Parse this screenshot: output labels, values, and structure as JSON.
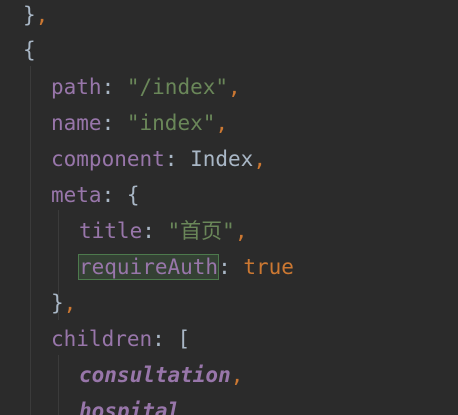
{
  "code": {
    "l1_brace": "}",
    "l1_comma": ",",
    "l2_brace": "{",
    "path_key": "path",
    "path_colon": ": ",
    "path_val": "\"/index\"",
    "path_comma": ",",
    "name_key": "name",
    "name_colon": ": ",
    "name_val": "\"index\"",
    "name_comma": ",",
    "component_key": "component",
    "component_colon": ": ",
    "component_val": "Index",
    "component_comma": ",",
    "meta_key": "meta",
    "meta_colon": ": {",
    "title_key": "title",
    "title_colon": ": ",
    "title_val": "\"首页\"",
    "title_comma": ",",
    "require_key": "requireAuth",
    "require_colon": ": ",
    "require_val": "true",
    "meta_close": "}",
    "meta_close_comma": ",",
    "children_key": "children",
    "children_colon": ": [",
    "child1": "consultation",
    "child1_comma": ",",
    "child2": "hospital"
  }
}
